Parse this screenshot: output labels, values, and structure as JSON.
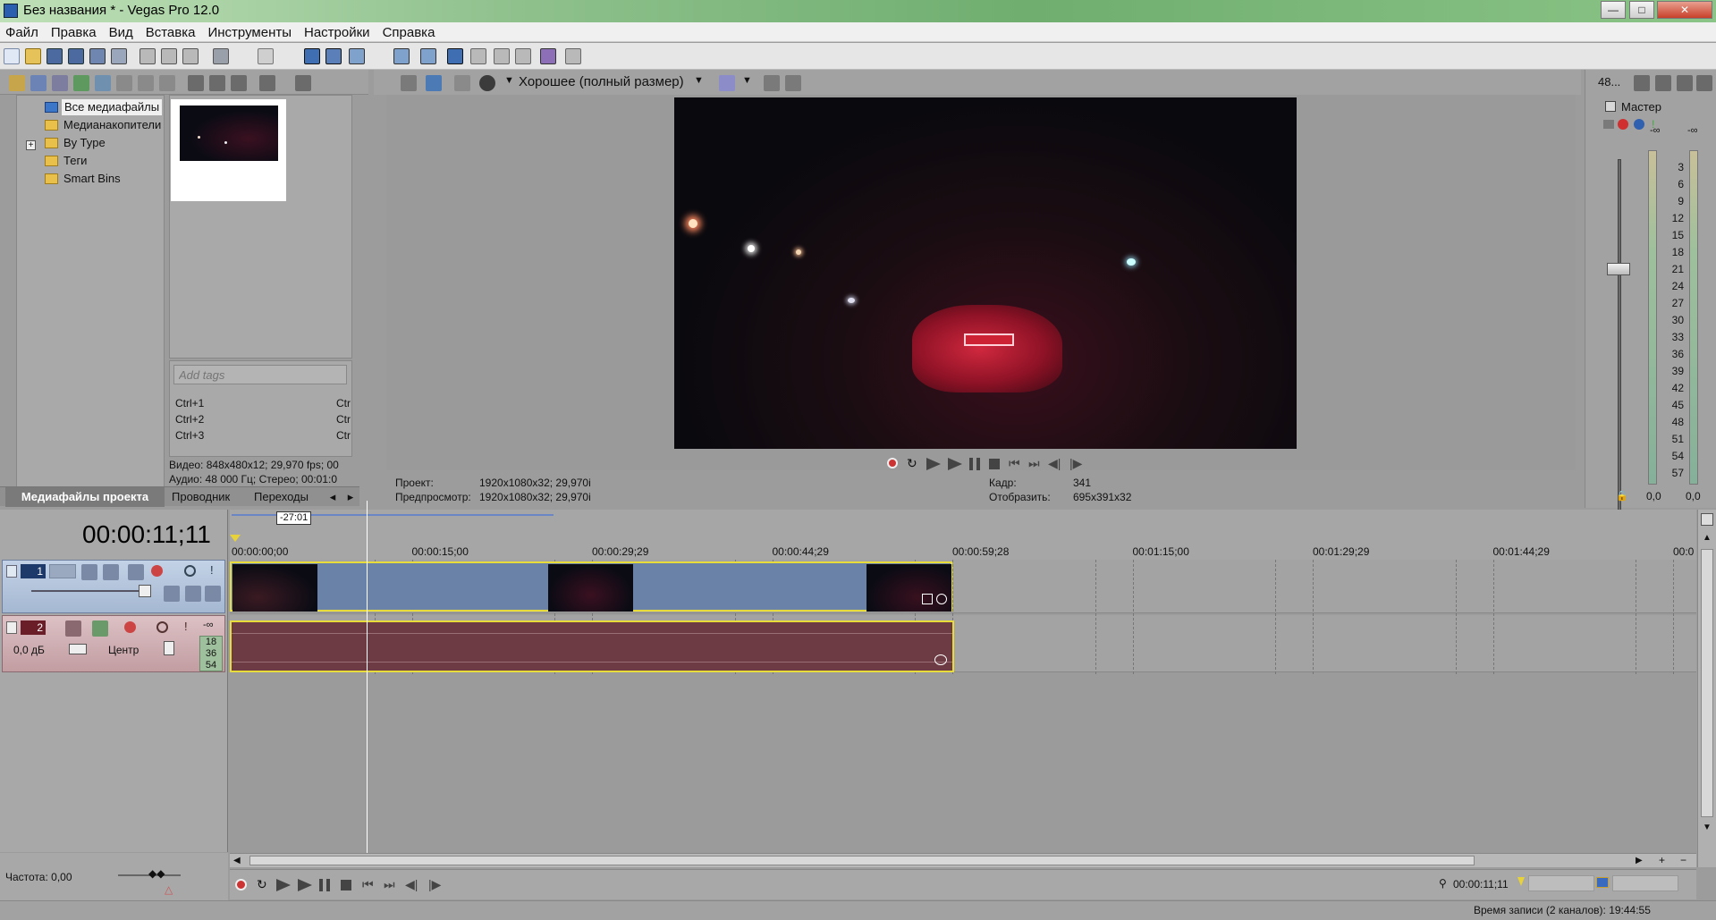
{
  "window": {
    "title": "Без названия * - Vegas Pro 12.0",
    "min": "—",
    "max": "□",
    "close": "✕"
  },
  "menu": [
    "Файл",
    "Правка",
    "Вид",
    "Вставка",
    "Инструменты",
    "Настройки",
    "Справка"
  ],
  "explorer": {
    "tree": [
      "Все медиафайлы",
      "Медианакопители",
      "By Type",
      "Теги",
      "Smart Bins"
    ],
    "tags_placeholder": "Add tags",
    "shortcuts": [
      {
        "key": "Ctrl+1",
        "right": "Ctr"
      },
      {
        "key": "Ctrl+2",
        "right": "Ctr"
      },
      {
        "key": "Ctrl+3",
        "right": "Ctr"
      }
    ],
    "info_video": "Видео: 848x480x12; 29,970 fps; 00",
    "info_audio": "Аудио: 48 000 Гц; Стерео; 00:01:0",
    "tabs": [
      "Медиафайлы проекта",
      "Проводник",
      "Переходы"
    ]
  },
  "preview": {
    "quality": "Хорошее (полный размер)",
    "project_label": "Проект:",
    "project_value": "1920x1080x32; 29,970i",
    "preview_label": "Предпросмотр:",
    "preview_value": "1920x1080x32; 29,970i",
    "frame_label": "Кадр:",
    "frame_value": "341",
    "display_label": "Отобразить:",
    "display_value": "695x391x32"
  },
  "master": {
    "label": "Мастер",
    "top_value": "48...",
    "scale": [
      "3",
      "6",
      "9",
      "12",
      "15",
      "18",
      "21",
      "24",
      "27",
      "30",
      "33",
      "36",
      "39",
      "42",
      "45",
      "48",
      "51",
      "54",
      "57"
    ],
    "inf_top_left": "-∞",
    "inf_top_right": "-∞",
    "bottom_left": "0,0",
    "bottom_right": "0,0"
  },
  "timeline": {
    "timecode": "00:00:11;11",
    "region_label": "-27:01",
    "ticks": [
      "00:00:00;00",
      "00:00:15;00",
      "00:00:29;29",
      "00:00:44;29",
      "00:00:59;28",
      "00:01:15;00",
      "00:01:29;29",
      "00:01:44;29",
      "00:0"
    ],
    "track1_number": "1",
    "track2_number": "2",
    "track2_volume": "0,0 дБ",
    "track2_pan": "Центр",
    "track2_meter_top": "-∞",
    "track2_meter": [
      "18",
      "36",
      "54"
    ],
    "rate": "Частота: 0,00",
    "cursor_time": "00:00:11;11",
    "status": "Время записи (2 каналов): 19:44:55"
  }
}
